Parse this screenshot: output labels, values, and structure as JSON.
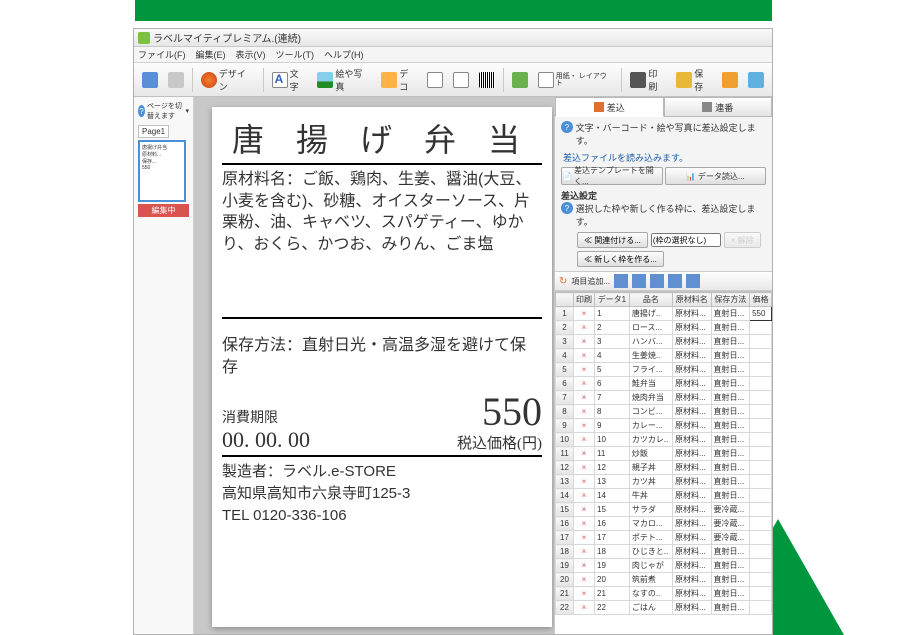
{
  "window": {
    "title": "ラベルマイティプレミアム.(連続)"
  },
  "menus": [
    "ファイル(F)",
    "編集(E)",
    "表示(V)",
    "ツール(T)",
    "ヘルプ(H)"
  ],
  "toolbar": {
    "design": "デザイン",
    "text": "文字",
    "photo": "絵や写真",
    "deco": "デコ",
    "layout": "用紙・\nレイアウト",
    "print": "印刷",
    "save": "保存"
  },
  "left": {
    "switch": "ページを切替えます",
    "page_tab": "Page1",
    "editing": "編集中"
  },
  "label": {
    "title": "唐 揚 げ 弁 当",
    "ingredients_label": "原材料名：",
    "ingredients": "ご飯、鶏肉、生姜、醤油(大豆、小麦を含む)、砂糖、オイスターソース、片栗粉、油、キャベツ、スパゲティー、ゆかり、おくら、かつお、みりん、ごま塩",
    "storage_label": "保存方法：",
    "storage": "直射日光・高温多湿を避けて保存",
    "expiry_label": "消費期限",
    "expiry_value": "00. 00. 00",
    "price": "550",
    "price_unit": "税込価格(円)",
    "maker_label": "製造者：",
    "maker_name": "ラベル.e-STORE",
    "maker_addr": "高知県高知市六泉寺町125-3",
    "maker_tel": "TEL 0120-336-106"
  },
  "right": {
    "tab_merge": "差込",
    "tab_seq": "連番",
    "hint1": "文字・バーコード・絵や写真に差込設定します。",
    "link1": "差込ファイルを読み込みます。",
    "btn_template": "差込テンプレートを開く...",
    "btn_data": "データ読込...",
    "section": "差込設定",
    "hint2": "選択した枠や新しく作る枠に、差込設定します。",
    "btn_relate": "≪ 関連付ける...",
    "no_select": "(枠の選択なし)",
    "btn_release": "× 解除",
    "btn_newframe": "≪ 新しく枠を作る...",
    "add_item": "項目追加...",
    "cols": [
      "",
      "印刷",
      "データ1",
      "品名",
      "原材料名",
      "保存方法",
      "価格"
    ],
    "rows": [
      {
        "n": 1,
        "d": 1,
        "name": "唐揚げ..",
        "ing": "原材料...",
        "st": "直射日...",
        "price": "550"
      },
      {
        "n": 2,
        "d": 2,
        "name": "ロース...",
        "ing": "原材料...",
        "st": "直射日..."
      },
      {
        "n": 3,
        "d": 3,
        "name": "ハンバ...",
        "ing": "原材料...",
        "st": "直射日..."
      },
      {
        "n": 4,
        "d": 4,
        "name": "生姜焼..",
        "ing": "原材料...",
        "st": "直射日..."
      },
      {
        "n": 5,
        "d": 5,
        "name": "フライ...",
        "ing": "原材料...",
        "st": "直射日..."
      },
      {
        "n": 6,
        "d": 6,
        "name": "鮭弁当",
        "ing": "原材料...",
        "st": "直射日..."
      },
      {
        "n": 7,
        "d": 7,
        "name": "焼肉弁当",
        "ing": "原材料...",
        "st": "直射日..."
      },
      {
        "n": 8,
        "d": 8,
        "name": "コンビ...",
        "ing": "原材料...",
        "st": "直射日..."
      },
      {
        "n": 9,
        "d": 9,
        "name": "カレー...",
        "ing": "原材料...",
        "st": "直射日..."
      },
      {
        "n": 10,
        "d": 10,
        "name": "カツカレ..",
        "ing": "原材料...",
        "st": "直射日..."
      },
      {
        "n": 11,
        "d": 11,
        "name": "炒飯",
        "ing": "原材料...",
        "st": "直射日..."
      },
      {
        "n": 12,
        "d": 12,
        "name": "親子丼",
        "ing": "原材料...",
        "st": "直射日..."
      },
      {
        "n": 13,
        "d": 13,
        "name": "カツ丼",
        "ing": "原材料...",
        "st": "直射日..."
      },
      {
        "n": 14,
        "d": 14,
        "name": "牛丼",
        "ing": "原材料...",
        "st": "直射日..."
      },
      {
        "n": 15,
        "d": 15,
        "name": "サラダ",
        "ing": "原材料...",
        "st": "要冷蔵..."
      },
      {
        "n": 16,
        "d": 16,
        "name": "マカロ...",
        "ing": "原材料...",
        "st": "要冷蔵..."
      },
      {
        "n": 17,
        "d": 17,
        "name": "ポテト...",
        "ing": "原材料...",
        "st": "要冷蔵..."
      },
      {
        "n": 18,
        "d": 18,
        "name": "ひじきと..",
        "ing": "原材料...",
        "st": "直射日..."
      },
      {
        "n": 19,
        "d": 19,
        "name": "肉じゃが",
        "ing": "原材料...",
        "st": "直射日..."
      },
      {
        "n": 20,
        "d": 20,
        "name": "筑前煮",
        "ing": "原材料...",
        "st": "直射日..."
      },
      {
        "n": 21,
        "d": 21,
        "name": "なすの..",
        "ing": "原材料...",
        "st": "直射日..."
      },
      {
        "n": 22,
        "d": 22,
        "name": "ごはん",
        "ing": "原材料...",
        "st": "直射日..."
      }
    ]
  }
}
